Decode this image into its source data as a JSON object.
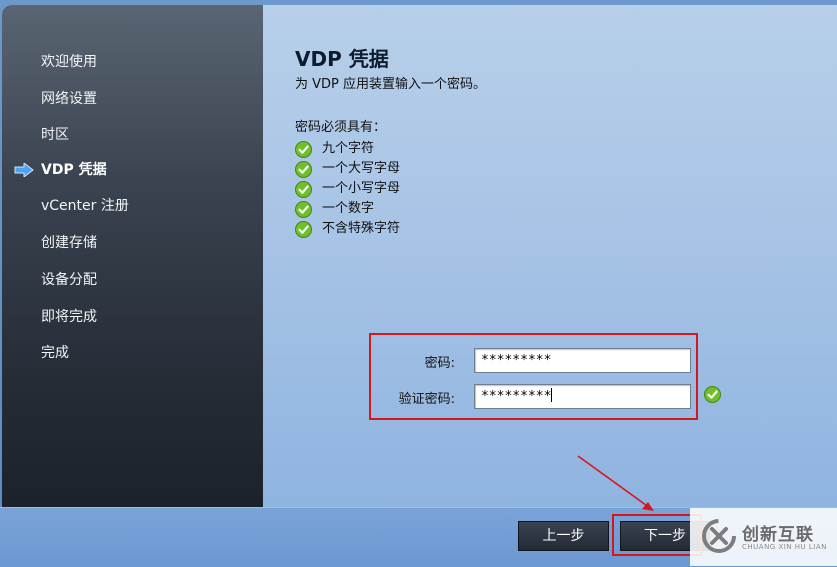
{
  "sidebar": {
    "items": [
      {
        "label": "欢迎使用"
      },
      {
        "label": "网络设置"
      },
      {
        "label": "时区"
      },
      {
        "label": "VDP 凭据",
        "active": true
      },
      {
        "label": "vCenter 注册"
      },
      {
        "label": "创建存储"
      },
      {
        "label": "设备分配"
      },
      {
        "label": "即将完成"
      },
      {
        "label": "完成"
      }
    ]
  },
  "main": {
    "title": "VDP 凭据",
    "subtitle": "为 VDP 应用装置输入一个密码。",
    "requirements_heading": "密码必须具有：",
    "requirements": [
      {
        "text": "九个字符",
        "icon": "green-check-icon",
        "met": true
      },
      {
        "text": "一个大写字母",
        "icon": "green-check-icon",
        "met": true
      },
      {
        "text": "一个小写字母",
        "icon": "green-check-icon",
        "met": true
      },
      {
        "text": "一个数字",
        "icon": "green-check-icon",
        "met": true
      },
      {
        "text": "不含特殊字符",
        "icon": "green-check-icon",
        "met": true
      }
    ],
    "password": {
      "label": "密码:",
      "value": "*********"
    },
    "confirm_password": {
      "label": "验证密码:",
      "value": "*********"
    }
  },
  "footer": {
    "prev_label": "上一步",
    "next_label": "下一步"
  },
  "watermark": {
    "text": "创新互联",
    "subtext": "CHUANG XIN HU LIAN"
  },
  "colors": {
    "highlight": "#d4171b",
    "check_green": "#6fbf2a",
    "nav_arrow": "#4da3f0"
  }
}
